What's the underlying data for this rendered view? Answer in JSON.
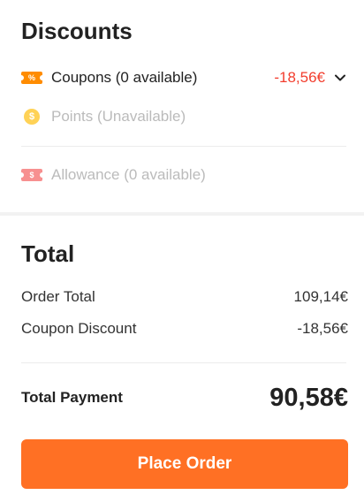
{
  "discounts": {
    "title": "Discounts",
    "coupons": {
      "label": "Coupons (0 available)",
      "amount": "-18,56€",
      "icon": "coupon-ticket-icon"
    },
    "points": {
      "label": "Points (Unavailable)",
      "icon": "points-coin-icon",
      "coin_symbol": "$"
    },
    "allowance": {
      "label": "Allowance (0 available)",
      "icon": "allowance-ticket-icon",
      "ticket_symbol": "$"
    },
    "coupon_ticket_symbol": "%"
  },
  "total": {
    "title": "Total",
    "order_total_label": "Order Total",
    "order_total_value": "109,14€",
    "coupon_discount_label": "Coupon Discount",
    "coupon_discount_value": "-18,56€",
    "total_payment_label": "Total Payment",
    "total_payment_value": "90,58€",
    "place_order_label": "Place Order"
  },
  "colors": {
    "accent": "#ff7024",
    "discount_red": "#f23d2d",
    "coupon_orange": "#ff8c00",
    "coin_yellow": "#ffc72c",
    "muted_text": "#bbbbbb"
  }
}
